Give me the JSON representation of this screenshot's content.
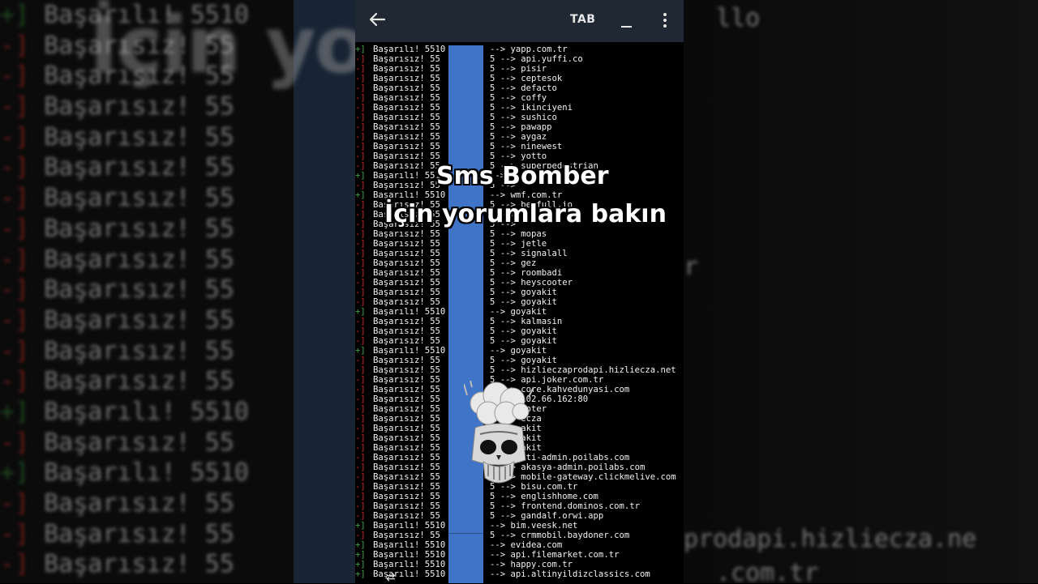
{
  "toolbar": {
    "tab_label": "TAB"
  },
  "overlay": {
    "line1": "Sms Bomber",
    "line2": "İçin yorumlara bakın"
  },
  "terminal": {
    "success_prefix": "+]",
    "fail_prefix": "-]",
    "success_word": "Başarılı! 5510",
    "fail_word": "Başarısız! 55",
    "fail_suffix": "5 -->",
    "success_suffix": "-->",
    "rows": [
      {
        "ok": true,
        "target": "yapp.com.tr"
      },
      {
        "ok": false,
        "target": "api.yuffi.co"
      },
      {
        "ok": false,
        "target": "pisir"
      },
      {
        "ok": false,
        "target": "ceptesok"
      },
      {
        "ok": false,
        "target": "defacto"
      },
      {
        "ok": false,
        "target": "coffy"
      },
      {
        "ok": false,
        "target": "ikinciyeni"
      },
      {
        "ok": false,
        "target": "sushico"
      },
      {
        "ok": false,
        "target": "pawapp"
      },
      {
        "ok": false,
        "target": "aygaz"
      },
      {
        "ok": false,
        "target": "ninewest"
      },
      {
        "ok": false,
        "target": "yotto"
      },
      {
        "ok": false,
        "target": "superpedestrian"
      },
      {
        "ok": true,
        "target": ""
      },
      {
        "ok": false,
        "target": ""
      },
      {
        "ok": true,
        "target": "wmf.com.tr"
      },
      {
        "ok": false,
        "target": "beefull.io"
      },
      {
        "ok": false,
        "target": ""
      },
      {
        "ok": false,
        "target": ""
      },
      {
        "ok": false,
        "target": "mopas"
      },
      {
        "ok": false,
        "target": "jetle"
      },
      {
        "ok": false,
        "target": "signalall"
      },
      {
        "ok": false,
        "target": "gez"
      },
      {
        "ok": false,
        "target": "roombadi"
      },
      {
        "ok": false,
        "target": "heyscooter"
      },
      {
        "ok": false,
        "target": "goyakit"
      },
      {
        "ok": false,
        "target": "goyakit"
      },
      {
        "ok": true,
        "target": "goyakit"
      },
      {
        "ok": false,
        "target": "kalmasin"
      },
      {
        "ok": false,
        "target": "goyakit"
      },
      {
        "ok": false,
        "target": "goyakit"
      },
      {
        "ok": true,
        "target": "goyakit"
      },
      {
        "ok": false,
        "target": "goyakit"
      },
      {
        "ok": false,
        "target": "hizlieczaprodapi.hizliecza.net"
      },
      {
        "ok": false,
        "target": "api.joker.com.tr"
      },
      {
        "ok": false,
        "target": "core.kahvedunyasi.com"
      },
      {
        "ok": false,
        "target": "102.66.162:80"
      },
      {
        "ok": false,
        "target": "ooter"
      },
      {
        "ok": false,
        "target": "ecza"
      },
      {
        "ok": false,
        "target": "akit"
      },
      {
        "ok": false,
        "target": "akit"
      },
      {
        "ok": false,
        "target": "akit"
      },
      {
        "ok": false,
        "target": "ati-admin.poilabs.com"
      },
      {
        "ok": false,
        "target": "akasya-admin.poilabs.com"
      },
      {
        "ok": false,
        "target": "mobile-gateway.clickmelive.com"
      },
      {
        "ok": false,
        "target": "bisu.com.tr"
      },
      {
        "ok": false,
        "target": "englishhome.com"
      },
      {
        "ok": false,
        "target": "frontend.dominos.com.tr"
      },
      {
        "ok": false,
        "target": "gandalf.orwi.app"
      },
      {
        "ok": true,
        "target": "bim.veesk.net"
      },
      {
        "ok": false,
        "target": "crmmobil.baydoner.com"
      },
      {
        "ok": true,
        "target": "evidea.com"
      },
      {
        "ok": true,
        "target": "api.filemarket.com.tr"
      },
      {
        "ok": true,
        "target": "happy.com.tr"
      },
      {
        "ok": true,
        "target": "api.altinyildizclassics.com"
      }
    ]
  },
  "background": {
    "caption_fragment": "İçin yo         n bakın",
    "ghost_1": "prodapi.hizliecza.ne",
    "ghost_2": ".com.tr",
    "ghost_3": "r",
    "ghost_4": "llo"
  },
  "colors": {
    "fail": "#c62828",
    "success": "#43a047",
    "topbar": "#1f2833",
    "blue_bar": "#3f74c7"
  }
}
